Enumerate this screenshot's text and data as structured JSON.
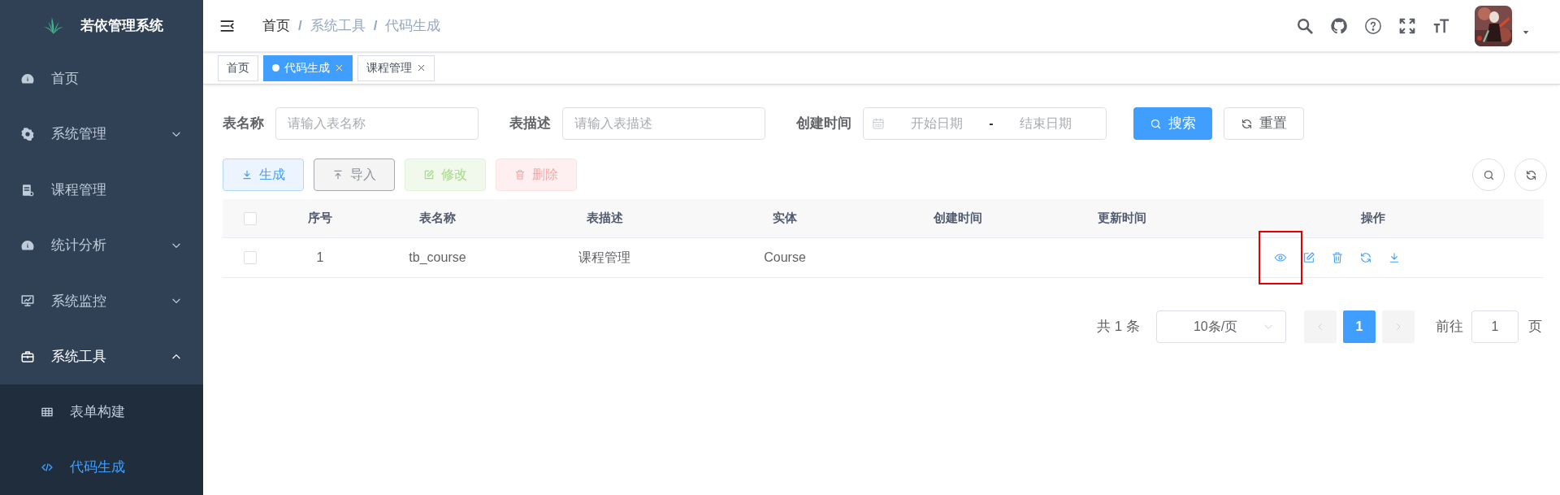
{
  "sidebar": {
    "logo": "若依管理系统",
    "items": [
      {
        "label": "首页",
        "kind": "link"
      },
      {
        "label": "系统管理",
        "kind": "submenu",
        "expanded": false
      },
      {
        "label": "课程管理",
        "kind": "link"
      },
      {
        "label": "统计分析",
        "kind": "submenu",
        "expanded": false
      },
      {
        "label": "系统监控",
        "kind": "submenu",
        "expanded": false
      },
      {
        "label": "系统工具",
        "kind": "submenu",
        "expanded": true,
        "children": [
          {
            "label": "表单构建",
            "selected": false
          },
          {
            "label": "代码生成",
            "selected": true
          }
        ]
      }
    ]
  },
  "breadcrumb": [
    {
      "label": "首页"
    },
    {
      "separator": "/",
      "label": "系统工具"
    },
    {
      "separator": "/",
      "label": "代码生成"
    }
  ],
  "tags": [
    {
      "label": "首页",
      "selected": false,
      "closable": false
    },
    {
      "label": "代码生成",
      "selected": true,
      "closable": true
    },
    {
      "label": "课程管理",
      "selected": false,
      "closable": true
    }
  ],
  "search_form": {
    "fields": [
      {
        "label": "表名称",
        "placeholder": "请输入表名称"
      },
      {
        "label": "表描述",
        "placeholder": "请输入表描述"
      }
    ],
    "date_range": {
      "label": "创建时间",
      "start_placeholder": "开始日期",
      "separator": "-",
      "end_placeholder": "结束日期"
    },
    "buttons": [
      {
        "label": "搜索",
        "kind": "primary"
      },
      {
        "label": "重置",
        "kind": "default"
      }
    ]
  },
  "toolbar": [
    {
      "label": "生成",
      "kind": "primary",
      "disabled": false
    },
    {
      "label": "导入",
      "kind": "info",
      "disabled": false
    },
    {
      "label": "修改",
      "kind": "success",
      "disabled": true
    },
    {
      "label": "删除",
      "kind": "danger",
      "disabled": true
    }
  ],
  "table": {
    "header_checked": false,
    "columns": [
      "序号",
      "表名称",
      "表描述",
      "实体",
      "创建时间",
      "更新时间",
      "操作"
    ],
    "rows": [
      {
        "checked": false,
        "cells": [
          "1",
          "tb_course",
          "课程管理",
          "Course"
        ],
        "actions": [
          {
            "kind": "preview",
            "highlighted": true
          },
          {
            "kind": "edit",
            "highlighted": false
          },
          {
            "kind": "delete",
            "highlighted": false
          },
          {
            "kind": "sync",
            "highlighted": false
          },
          {
            "kind": "download",
            "highlighted": false
          }
        ]
      }
    ]
  },
  "pagination": {
    "total": "共 1 条",
    "page_size": "10条/页",
    "pages": [
      {
        "label": "1",
        "selected": true
      }
    ],
    "goto_label": "前往",
    "goto_value": "1",
    "goto_suffix": "页"
  }
}
